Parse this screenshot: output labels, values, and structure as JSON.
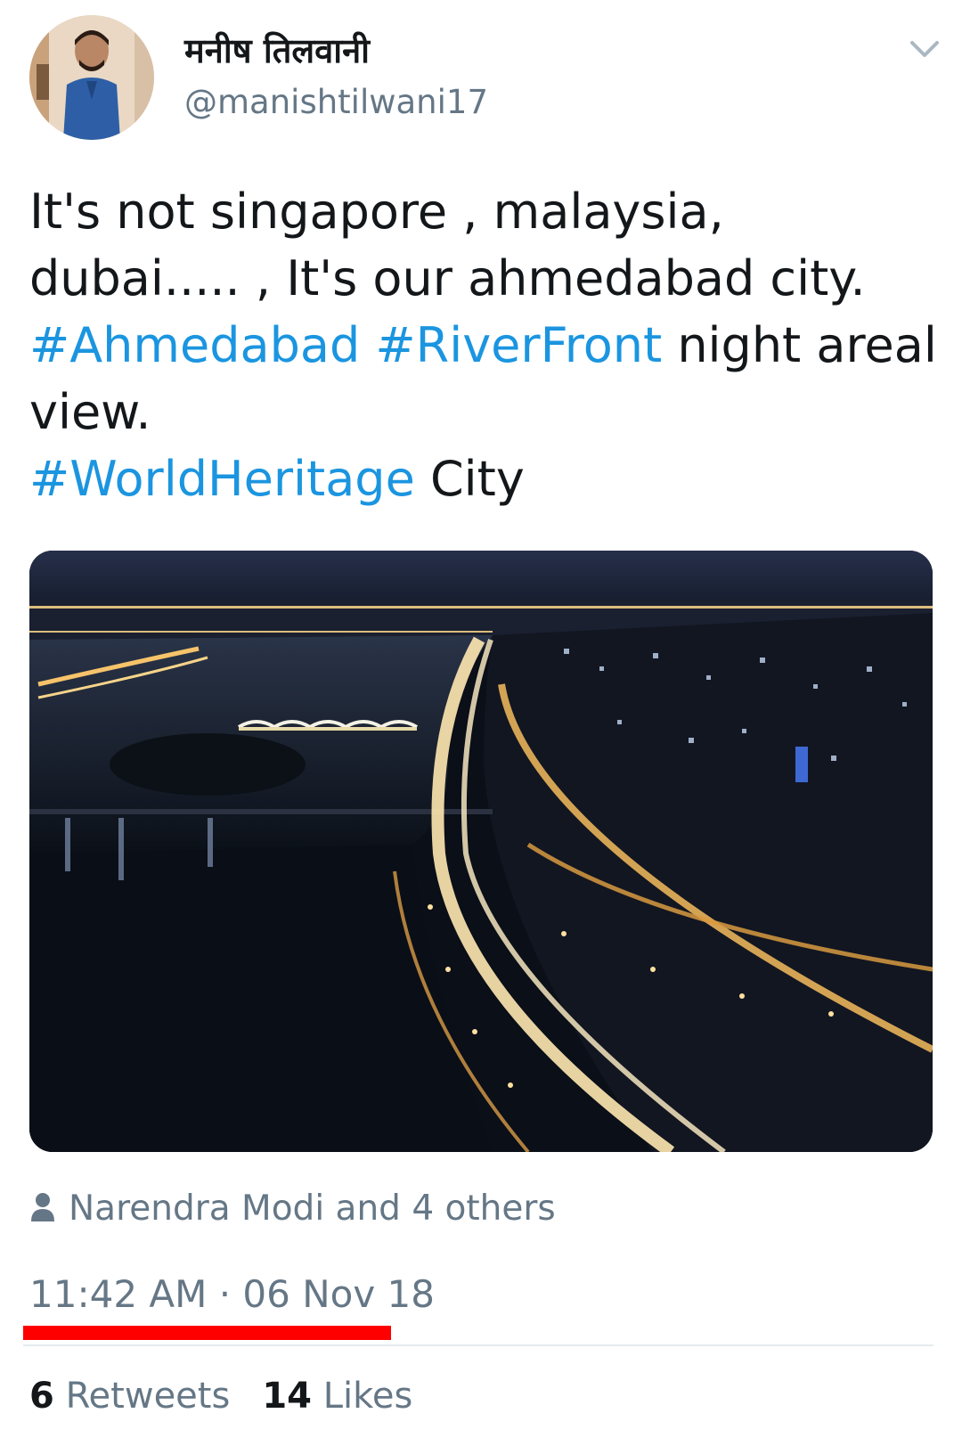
{
  "user": {
    "display_name": "मनीष तिलवानी",
    "handle": "@manishtilwani17"
  },
  "tweet": {
    "line1": "It's not singapore , malaysia,",
    "line2": "dubai..... , It's our ahmedabad city.",
    "hashtag_ahmedabad": "#Ahmedabad",
    "hashtag_riverfront": "#RiverFront",
    "line3_tail": "night areal",
    "line4": "view.",
    "hashtag_worldheritage": "#WorldHeritage",
    "line5_tail": "City"
  },
  "liked_by": "Narendra Modi and 4 others",
  "timestamp": "11:42 AM · 06 Nov 18",
  "stats": {
    "retweets_count": "6",
    "retweets_label": "Retweets",
    "likes_count": "14",
    "likes_label": "Likes"
  },
  "colors": {
    "hashtag": "#1b95e0",
    "secondary_text": "#657786",
    "annotation_underline": "#ff0000"
  },
  "icons": {
    "menu": "chevron-down-icon",
    "liked_by": "person-icon"
  }
}
